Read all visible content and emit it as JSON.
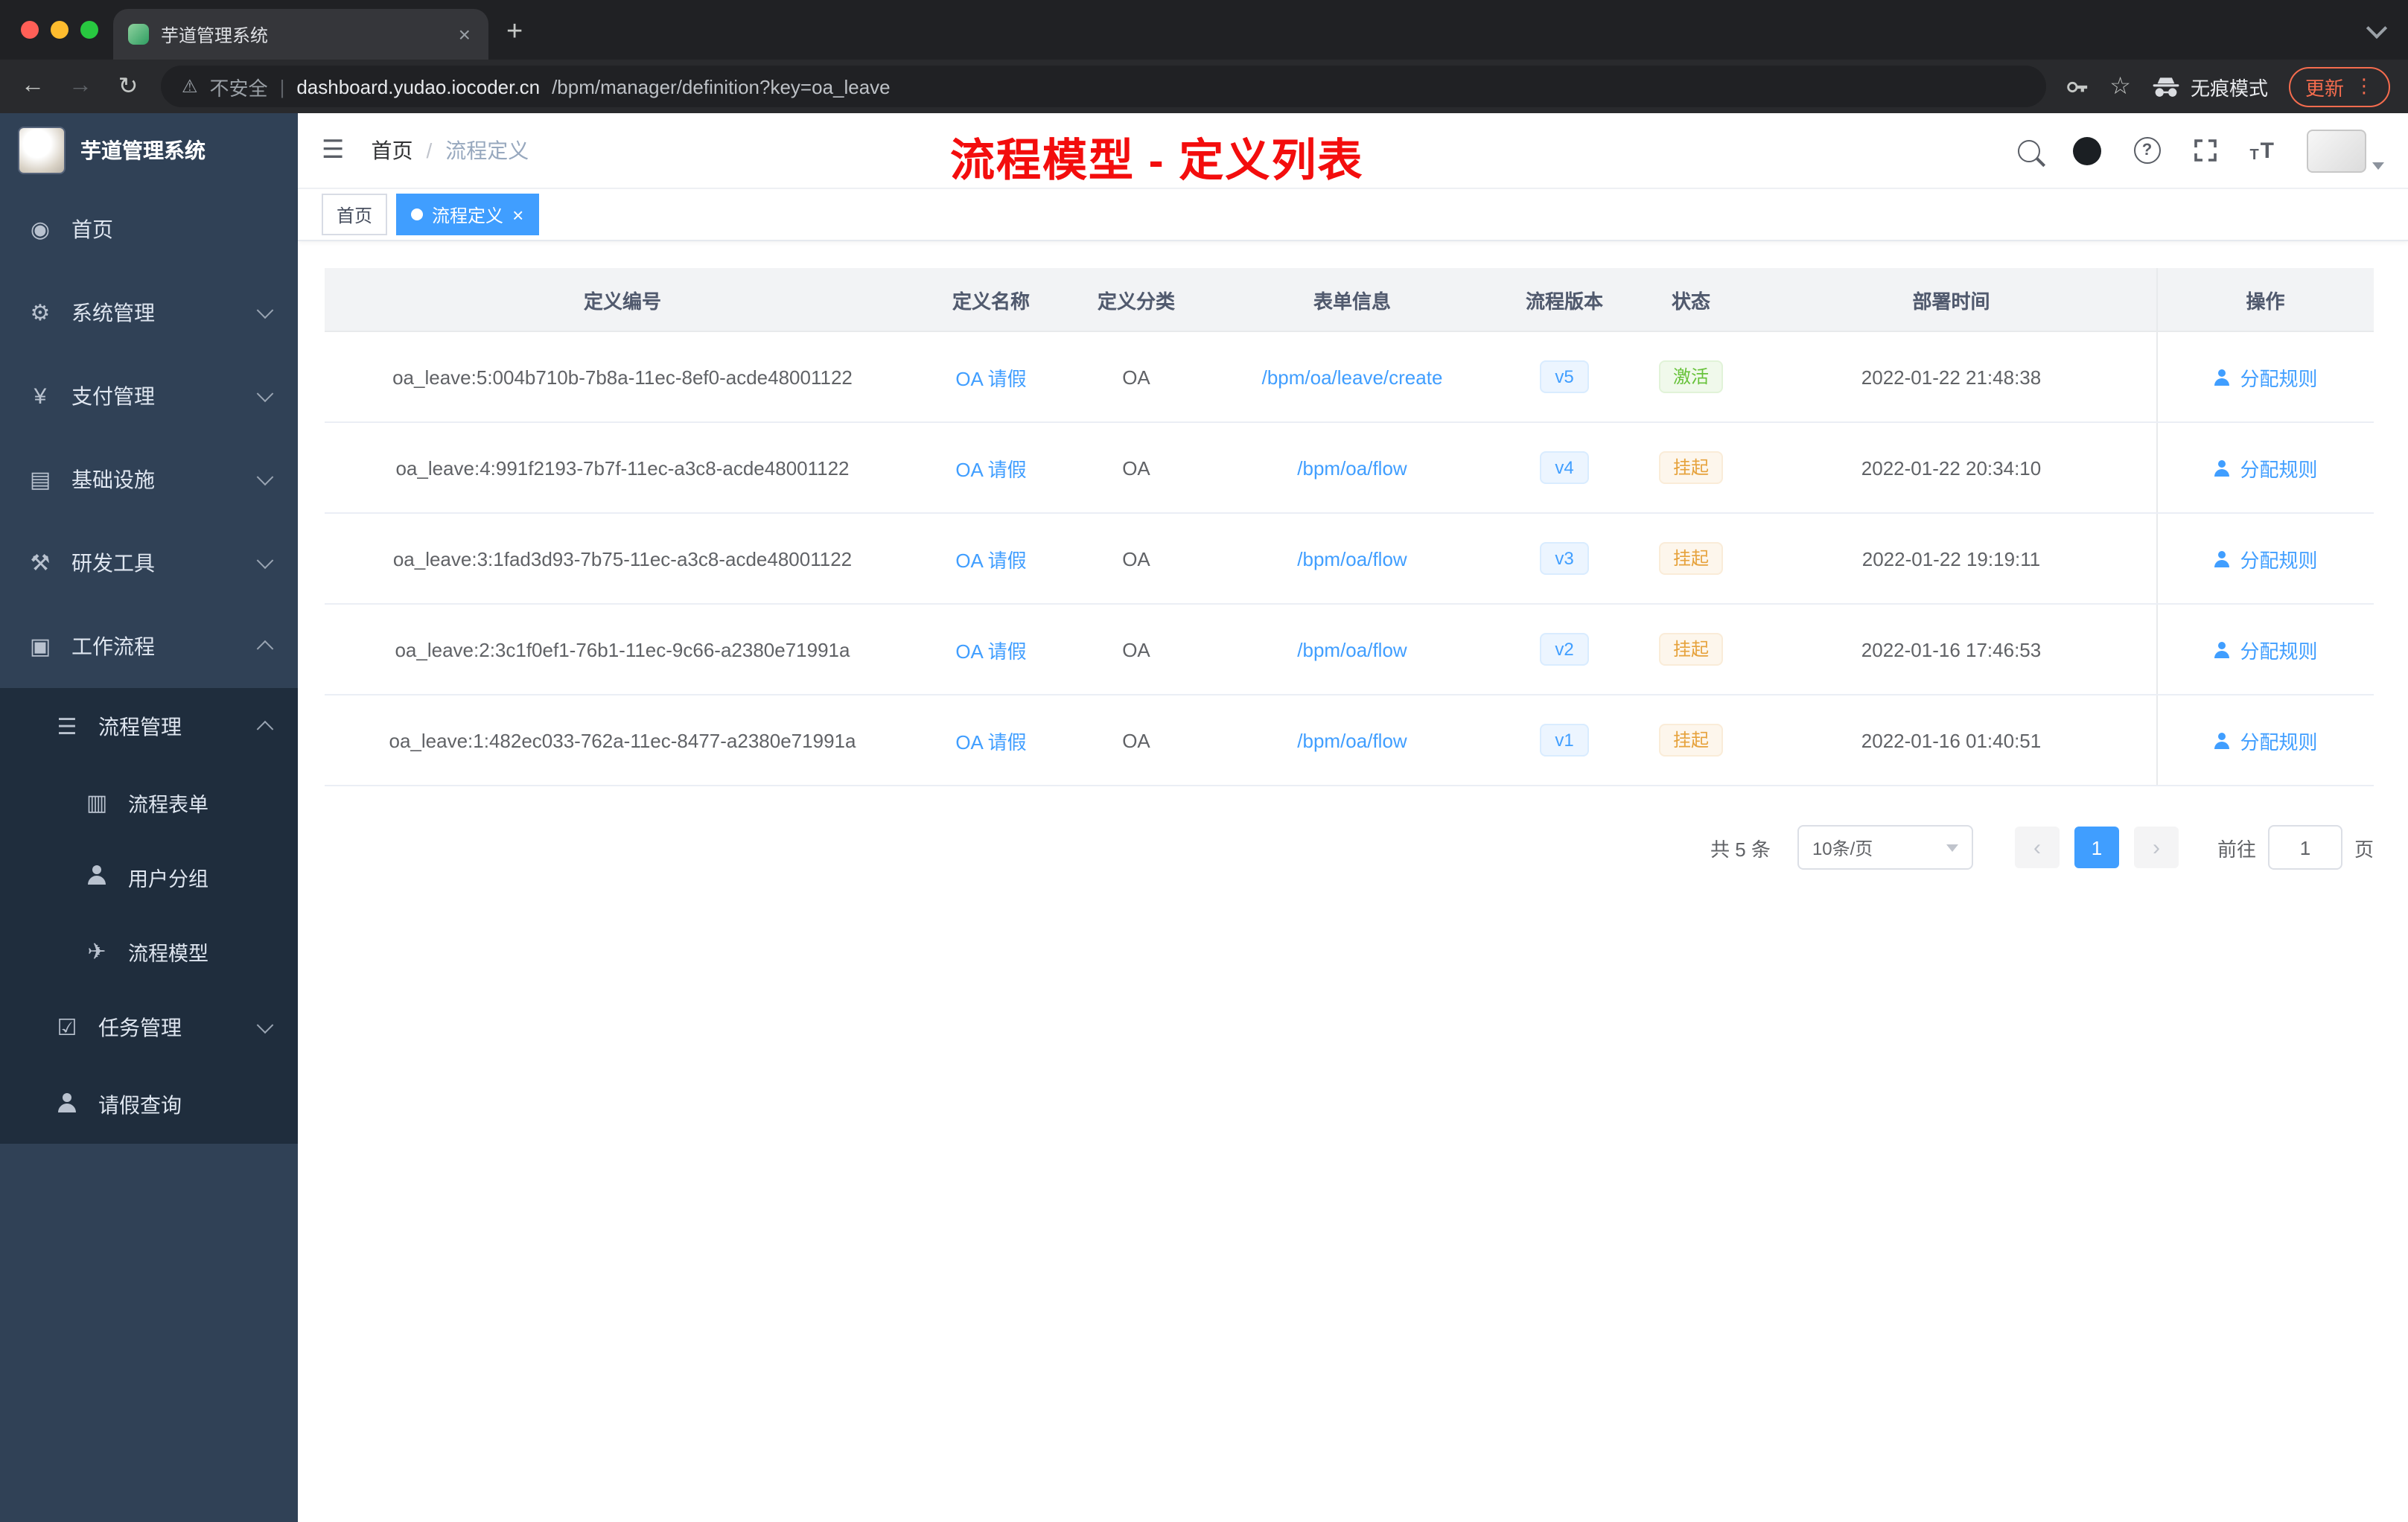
{
  "browser": {
    "tab_title": "芋道管理系统",
    "security_label": "不安全",
    "url_domain": "dashboard.yudao.iocoder.cn",
    "url_path": "/bpm/manager/definition?key=oa_leave",
    "incognito_label": "无痕模式",
    "update_label": "更新"
  },
  "icons": {
    "back": "←",
    "forward": "→",
    "reload": "↻",
    "warning": "⚠",
    "divider": "|",
    "star": "☆",
    "overflow_dots": "⋮",
    "new_tab": "+",
    "close": "×",
    "hamburger": "☰",
    "question": "?",
    "font_small": "T",
    "font_big": "T",
    "prev": "‹",
    "next": "›"
  },
  "sidebar": {
    "logo_title": "芋道管理系统",
    "items": [
      {
        "label": "首页",
        "icon": "◉"
      },
      {
        "label": "系统管理",
        "icon": "⚙"
      },
      {
        "label": "支付管理",
        "icon": "¥"
      },
      {
        "label": "基础设施",
        "icon": "▤"
      },
      {
        "label": "研发工具",
        "icon": "⚒"
      },
      {
        "label": "工作流程",
        "icon": "▣"
      },
      {
        "label": "流程管理",
        "icon": "☰"
      },
      {
        "label": "流程表单",
        "icon": "▥"
      },
      {
        "label": "用户分组",
        "icon": ""
      },
      {
        "label": "流程模型",
        "icon": "✈"
      },
      {
        "label": "任务管理",
        "icon": "☑"
      },
      {
        "label": "请假查询",
        "icon": ""
      }
    ]
  },
  "header": {
    "breadcrumb": {
      "home": "首页",
      "separator": "/",
      "current": "流程定义"
    },
    "annotation": "流程模型 - 定义列表"
  },
  "tags": {
    "home": "首页",
    "active": "流程定义"
  },
  "table": {
    "columns": [
      "定义编号",
      "定义名称",
      "定义分类",
      "表单信息",
      "流程版本",
      "状态",
      "部署时间",
      "操作"
    ],
    "rows": [
      {
        "id": "oa_leave:5:004b710b-7b8a-11ec-8ef0-acde48001122",
        "name": "OA 请假",
        "category": "OA",
        "form": "/bpm/oa/leave/create",
        "version": "v5",
        "status": "激活",
        "time": "2022-01-22 21:48:38",
        "action": "分配规则"
      },
      {
        "id": "oa_leave:4:991f2193-7b7f-11ec-a3c8-acde48001122",
        "name": "OA 请假",
        "category": "OA",
        "form": "/bpm/oa/flow",
        "version": "v4",
        "status": "挂起",
        "time": "2022-01-22 20:34:10",
        "action": "分配规则"
      },
      {
        "id": "oa_leave:3:1fad3d93-7b75-11ec-a3c8-acde48001122",
        "name": "OA 请假",
        "category": "OA",
        "form": "/bpm/oa/flow",
        "version": "v3",
        "status": "挂起",
        "time": "2022-01-22 19:19:11",
        "action": "分配规则"
      },
      {
        "id": "oa_leave:2:3c1f0ef1-76b1-11ec-9c66-a2380e71991a",
        "name": "OA 请假",
        "category": "OA",
        "form": "/bpm/oa/flow",
        "version": "v2",
        "status": "挂起",
        "time": "2022-01-16 17:46:53",
        "action": "分配规则"
      },
      {
        "id": "oa_leave:1:482ec033-762a-11ec-8477-a2380e71991a",
        "name": "OA 请假",
        "category": "OA",
        "form": "/bpm/oa/flow",
        "version": "v1",
        "status": "挂起",
        "time": "2022-01-16 01:40:51",
        "action": "分配规则"
      }
    ]
  },
  "pagination": {
    "total": "共 5 条",
    "page_size": "10条/页",
    "current_page": "1",
    "goto_label": "前往",
    "goto_value": "1",
    "page_unit": "页"
  },
  "colors": {
    "accent": "#409eff",
    "success": "#67c23a",
    "warning": "#e6a23c",
    "annotation": "#f30d0d"
  }
}
